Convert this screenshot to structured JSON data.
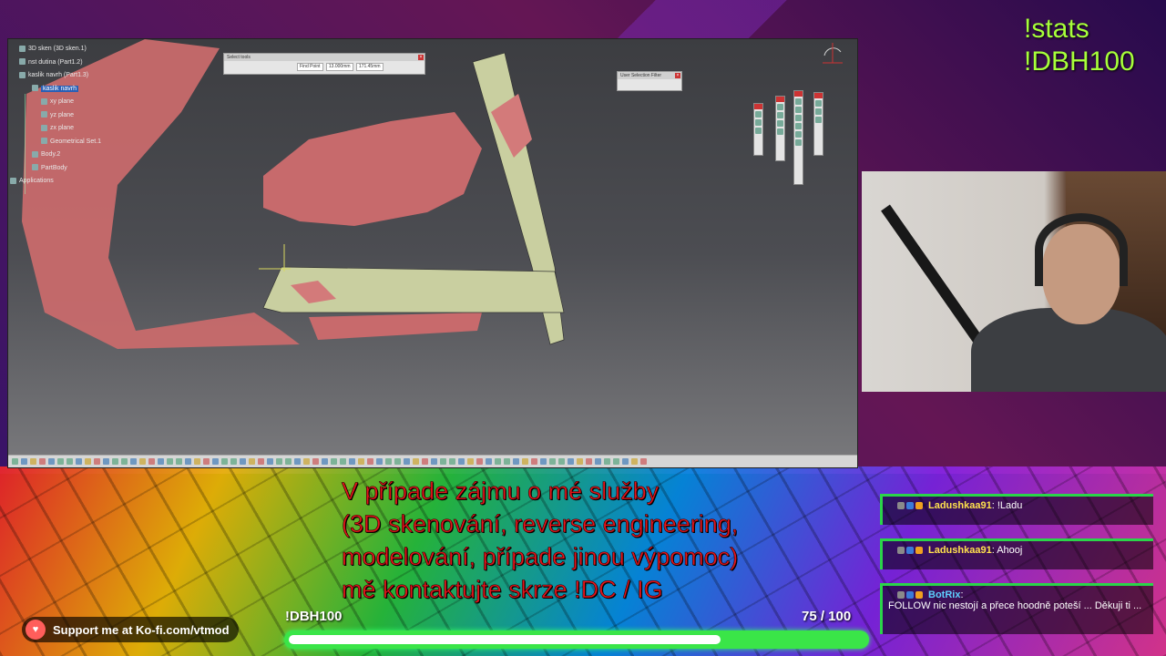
{
  "overlay": {
    "stats_command": "!stats",
    "goal_command": "!DBH100",
    "subtitle_lines": [
      "V případe zájmu o mé služby",
      "(3D skenování, reverse engineering,",
      "modelování, případe jinou výpomoc)",
      "mě kontaktujte skrze !DC / IG"
    ]
  },
  "goal": {
    "title": "!DBH100",
    "current": 75,
    "target": 100,
    "count_text": "75  / 100",
    "fraction": 0.75,
    "color": "#3ae548"
  },
  "kofi": {
    "text": "Support me at Ko-fi.com/vtmod",
    "icon": "ko-fi-cup-icon"
  },
  "cad": {
    "tree": [
      {
        "label": "3D sken (3D sken.1)",
        "selected": false
      },
      {
        "label": "nst dutina (Part1.2)",
        "selected": false
      },
      {
        "label": "kaslik navrh (Part1.3)",
        "selected": false
      },
      {
        "label": "kaslik navrh",
        "selected": true
      },
      {
        "label": "xy plane",
        "selected": false
      },
      {
        "label": "yz plane",
        "selected": false
      },
      {
        "label": "zx plane",
        "selected": false
      },
      {
        "label": "Geometrical Set.1",
        "selected": false
      },
      {
        "label": "Body.2",
        "selected": false
      },
      {
        "label": "PartBody",
        "selected": false
      },
      {
        "label": "Applications",
        "selected": false
      }
    ],
    "select_dialog": {
      "title": "Select tools",
      "field1": "Find Point",
      "field2": "13.000mm",
      "field3": "171.45mm"
    },
    "filter_dialog": {
      "title": "User Selection Filter"
    }
  },
  "chat": [
    {
      "user": "Ladushkaa91",
      "text": "!Ladu",
      "bot": false
    },
    {
      "user": "Ladushkaa91",
      "text": "Ahooj",
      "bot": false
    },
    {
      "user": "BotRix",
      "text": "FOLLOW nic nestojí a přece hoodně poteší ... Děkuji ti ...",
      "bot": true
    }
  ],
  "colors": {
    "accent_green": "#3ae548",
    "subtitle_red": "#e3141b",
    "stats_green": "#a7ff3a"
  }
}
